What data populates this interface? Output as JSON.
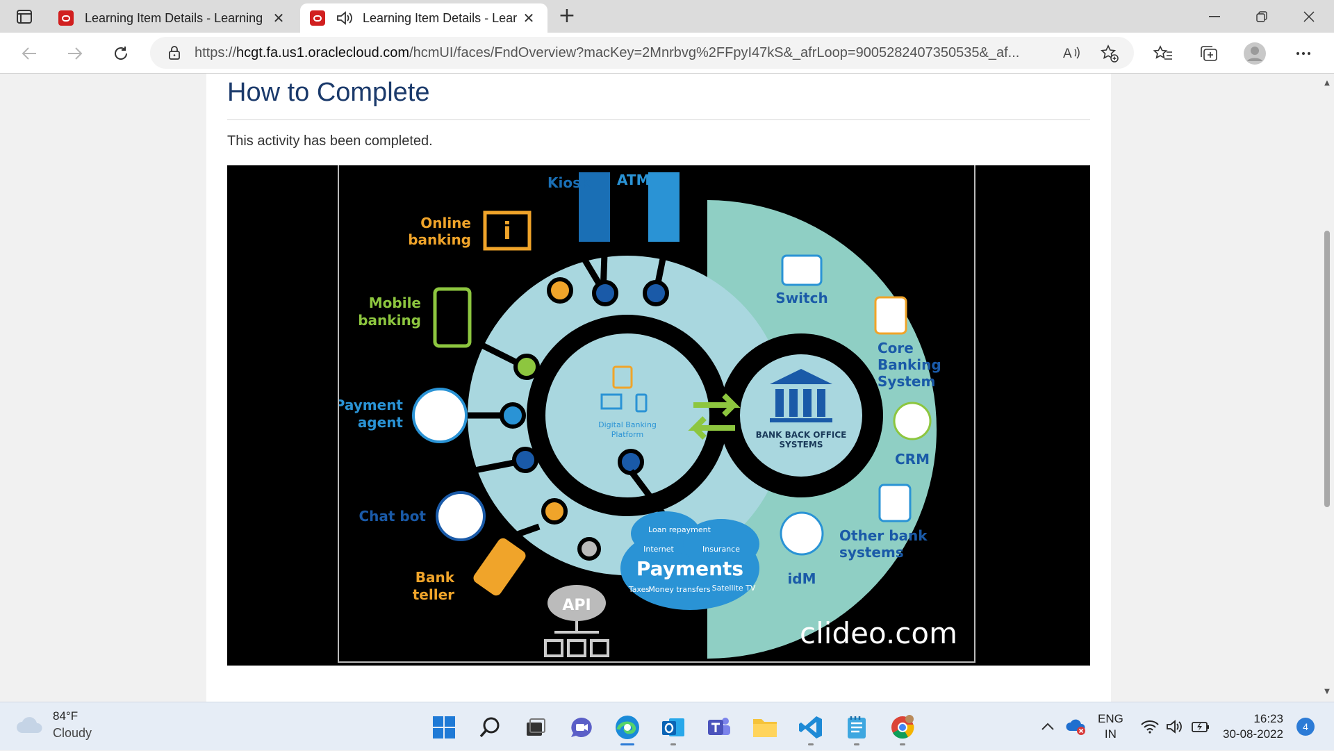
{
  "browser": {
    "tabs": [
      {
        "title": "Learning Item Details - Learning"
      },
      {
        "title": "Learning Item Details - Lear"
      }
    ],
    "url_host_prefix": "https://",
    "url_host": "hcgt.fa.us1.oraclecloud.com",
    "url_path": "/hcmUI/faces/FndOverview?macKey=2Mnrbvg%2FFpyI47kS&_afrLoop=9005282407350535&_af..."
  },
  "page": {
    "section_title": "How to Complete",
    "status_text": "This activity has been completed."
  },
  "video_graphic": {
    "center_label": "Digital Banking Platform",
    "back_office_label": "BANK BACK OFFICE SYSTEMS",
    "channels": [
      "Kiosk",
      "ATM",
      "Online banking",
      "Mobile banking",
      "Payment agent",
      "Chat bot",
      "Bank teller",
      "API"
    ],
    "systems": [
      "Switch",
      "Core Banking System",
      "CRM",
      "Other bank systems",
      "idM"
    ],
    "payments_title": "Payments",
    "payments_items": [
      "Loan repayment",
      "Internet",
      "Insurance",
      "Taxes",
      "Money transfers",
      "Satellite TV"
    ],
    "watermark": "clideo.com"
  },
  "taskbar": {
    "weather_temp": "84°F",
    "weather_cond": "Cloudy",
    "lang_top": "ENG",
    "lang_bottom": "IN",
    "time": "16:23",
    "date": "30-08-2022",
    "notification_count": "4"
  },
  "colors": {
    "accent": "#1b3a6b",
    "ring": "#a9d7df",
    "outer": "#8fcfc4",
    "orange": "#f0a42a",
    "green": "#8dc63f",
    "blue": "#2a93d5"
  }
}
